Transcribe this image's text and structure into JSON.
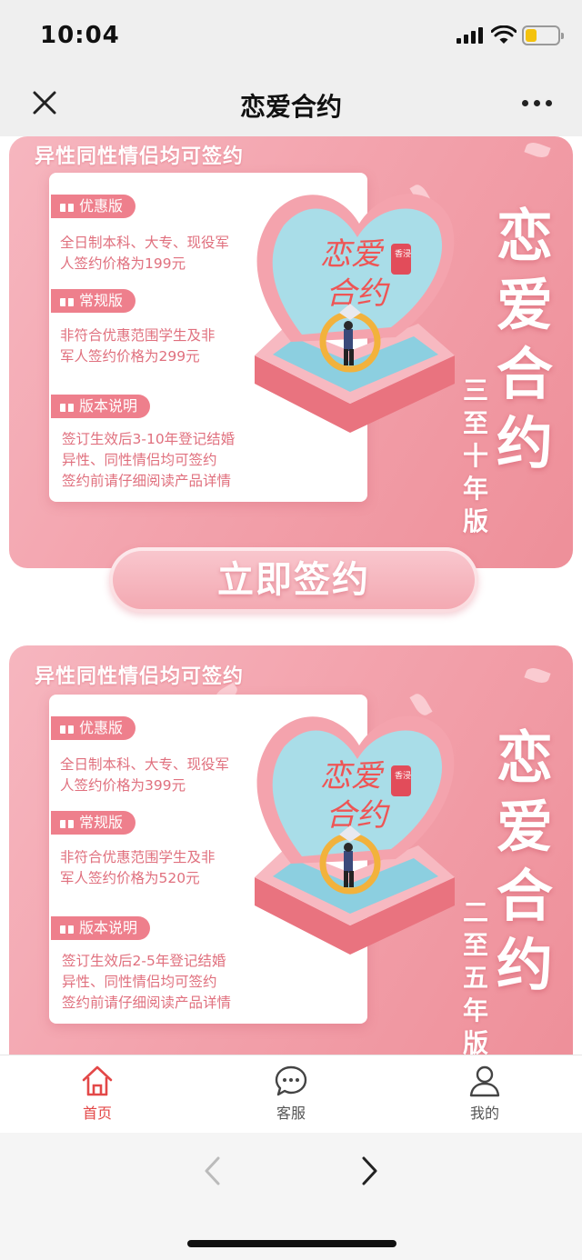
{
  "status": {
    "time": "10:04"
  },
  "nav": {
    "title": "恋爱合约"
  },
  "cards": [
    {
      "ribbon": "异性同性情侣均可签约",
      "tag1": "优惠版",
      "text1": [
        "全日制本科、大专、现役军",
        "人签约价格为199元"
      ],
      "tag2": "常规版",
      "text2": [
        "非符合优惠范围学生及非",
        "军人签约价格为299元"
      ],
      "tag3": "版本说明",
      "text3": [
        "签订生效后3-10年登记结婚",
        "异性、同性情侣均可签约",
        "签约前请仔细阅读产品详情"
      ],
      "title_chars": [
        "恋",
        "爱",
        "合",
        "约"
      ],
      "sub_chars": [
        "三",
        "至",
        "十",
        "年",
        "版"
      ],
      "art_line1": "恋爱",
      "art_line2": "合约",
      "seal": "香浸"
    },
    {
      "ribbon": "异性同性情侣均可签约",
      "tag1": "优惠版",
      "text1": [
        "全日制本科、大专、现役军",
        "人签约价格为399元"
      ],
      "tag2": "常规版",
      "text2": [
        "非符合优惠范围学生及非",
        "军人签约价格为520元"
      ],
      "tag3": "版本说明",
      "text3": [
        "签订生效后2-5年登记结婚",
        "异性、同性情侣均可签约",
        "签约前请仔细阅读产品详情"
      ],
      "title_chars": [
        "恋",
        "爱",
        "合",
        "约"
      ],
      "sub_chars": [
        "二",
        "至",
        "五",
        "年",
        "版"
      ],
      "art_line1": "恋爱",
      "art_line2": "合约",
      "seal": "香浸"
    }
  ],
  "sign_button": "立即签约",
  "tabs": [
    {
      "label": "首页",
      "icon": "home-icon"
    },
    {
      "label": "客服",
      "icon": "chat-icon"
    },
    {
      "label": "我的",
      "icon": "user-icon"
    }
  ],
  "colors": {
    "accent": "#e34848",
    "card_pink": "#f3a3ad",
    "tag_pink": "#ee7f8c"
  }
}
